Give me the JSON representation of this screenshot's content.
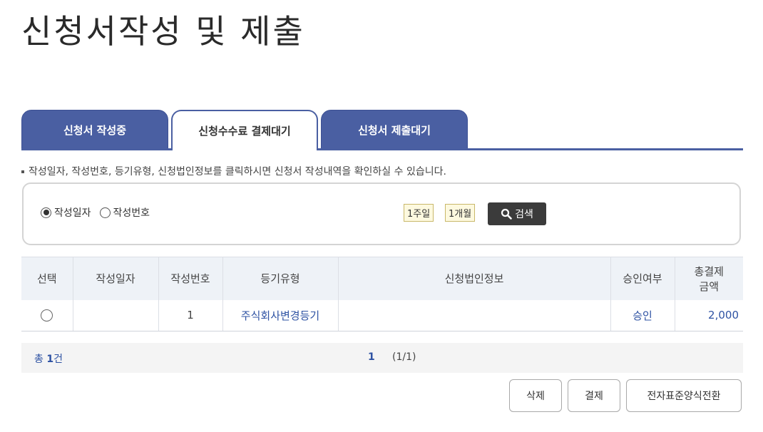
{
  "page": {
    "title": "신청서작성 및 제출"
  },
  "tabs": [
    {
      "label": "신청서 작성중"
    },
    {
      "label": "신청수수료 결제대기"
    },
    {
      "label": "신청서 제출대기"
    }
  ],
  "notice": "작성일자, 작성번호, 등기유형, 신청법인정보를 클릭하시면 신청서 작성내역을 확인하실 수 있습니다.",
  "search": {
    "radios": [
      {
        "label": "작성일자",
        "checked": true
      },
      {
        "label": "작성번호",
        "checked": false
      }
    ],
    "period_week": "1주일",
    "period_month": "1개월",
    "search_label": "검색"
  },
  "table": {
    "headers": [
      "선택",
      "작성일자",
      "작성번호",
      "등기유형",
      "신청법인정보",
      "승인여부",
      "총결제\n금액"
    ],
    "header_amount_line1": "총결제",
    "header_amount_line2": "금액",
    "rows": [
      {
        "date": "",
        "number": "1",
        "type": "주식회사변경등기",
        "corp": "",
        "approval": "승인",
        "amount": "2,000"
      }
    ]
  },
  "pager": {
    "total_prefix": "총",
    "total_count": "1",
    "total_suffix": "건",
    "current_page": "1",
    "page_info": "(1/1)"
  },
  "actions": {
    "delete": "삭제",
    "pay": "결제",
    "convert": "전자표준양식전환"
  }
}
